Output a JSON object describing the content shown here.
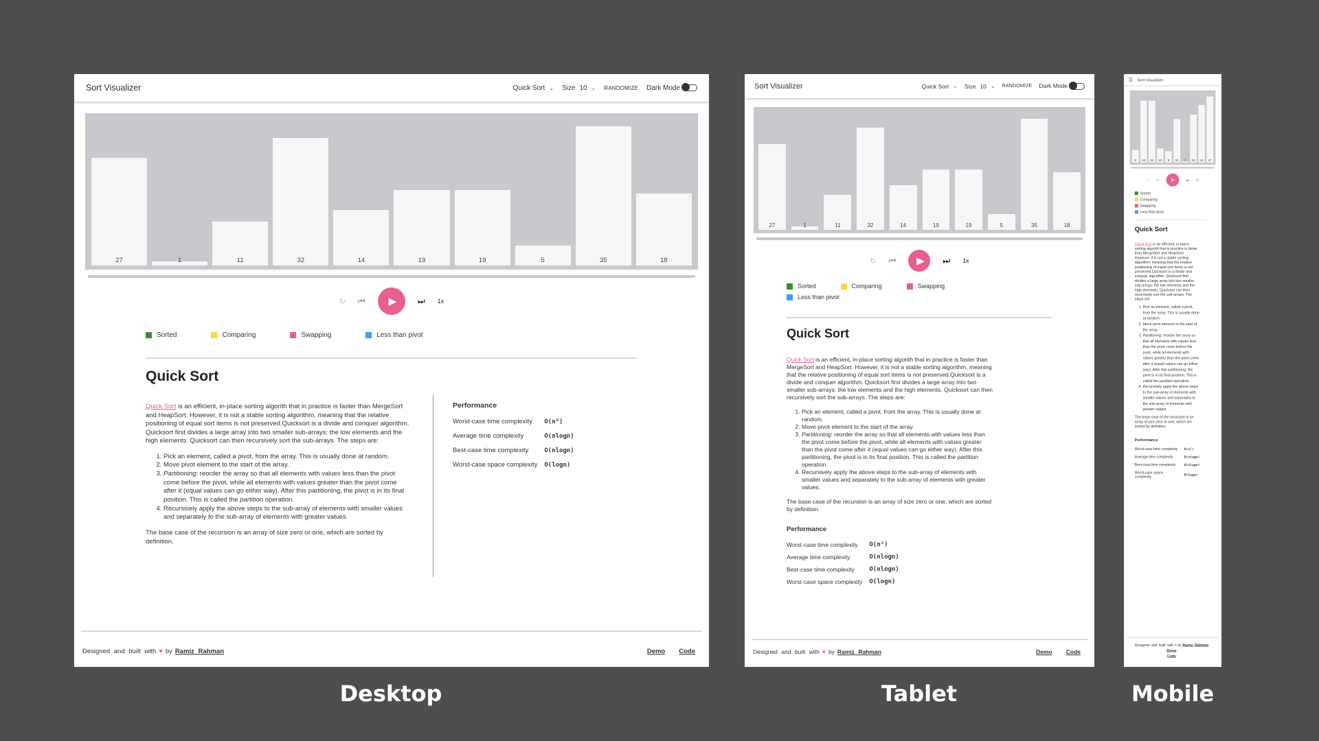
{
  "app": {
    "title": "Sort Visualizer",
    "algorithm": "Quick Sort",
    "size_label": "Size",
    "size_value": "10",
    "randomize": "RANDOMIZE",
    "dark_mode": "Dark Mode",
    "dark_mode_on": false
  },
  "devices": [
    {
      "label": "Desktop",
      "bars": [
        27,
        1,
        11,
        32,
        14,
        19,
        19,
        5,
        35,
        18
      ]
    },
    {
      "label": "Tablet",
      "bars": [
        27,
        1,
        11,
        32,
        14,
        19,
        19,
        5,
        35,
        18
      ]
    },
    {
      "label": "Mobile",
      "bars": [
        9,
        44,
        44,
        10,
        8,
        31,
        1,
        34,
        41,
        47
      ]
    }
  ],
  "controls": {
    "speed": "1x",
    "icons": [
      "repeat-icon",
      "step-back-icon",
      "play-icon",
      "step-forward-icon"
    ],
    "play_color": "#e8608f"
  },
  "legend": [
    {
      "label": "Sorted",
      "color": "#3d8b37"
    },
    {
      "label": "Comparing",
      "color": "#f9d34a"
    },
    {
      "label": "Swapping",
      "color": "#e8608f"
    },
    {
      "label": "Less than pivot",
      "color": "#3d9df2"
    }
  ],
  "article": {
    "title": "Quick Sort",
    "link": "Quick Sort",
    "intro": " is an efficient, in-place sorting algorith that in practice is faster than MergeSort and HeapSort. However, it is not a stable sorting algorithm, meaning that the relative positioning of equal sort items is not preserved.Quicksort is a divide and conquer algorithm. Quicksort first divides a large array into two smaller sub-arrays: the low elements and the high elements. Quicksort can then recursively sort the sub-arrays. The steps are:",
    "step1": "Pick an element, called a pivot, from the array. This is usually done at random.",
    "step2": "Move pivot element to the start of the array.",
    "step3_em": "Partitioning",
    "step3": ": reorder the array so that all elements with values less than the pivot come before the pivot, while all elements with values greater than the pivot come after it (equal values can go either way). After this partitioning, the pivot is in its final position. This is called the ",
    "step3_em2": "partition",
    "step3_end": " operation.",
    "step4": "Recursively apply the above steps to the sub-array of elements with smaller values and separately to the sub-array of elements with greater values.",
    "base_case": "The base case of the recursion is an array of size zero or one, which are sorted by definition."
  },
  "performance": {
    "title": "Performance",
    "rows": [
      {
        "label": "Worst-case time complexity",
        "value": "O(n²)"
      },
      {
        "label": "Average time complexity",
        "value": "O(nlogn)"
      },
      {
        "label": "Best-case time complexity",
        "value": "O(nlogn)"
      },
      {
        "label": "Worst-case space complexity",
        "value": "O(logn)"
      }
    ]
  },
  "footer": {
    "designed": "Designed and built with",
    "by": "by",
    "author": "Ramiz Rahman",
    "demo": "Demo",
    "code": "Code"
  }
}
